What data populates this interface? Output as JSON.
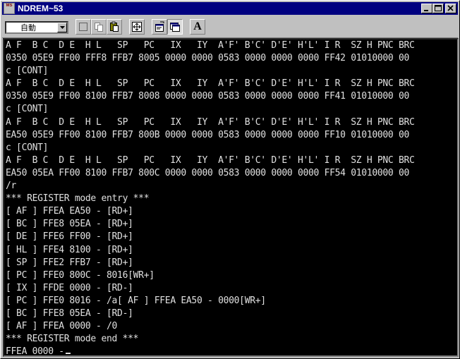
{
  "window": {
    "title": "NDREM~53",
    "icon_text": "MS"
  },
  "titlebar_buttons": {
    "minimize": "minimize-icon",
    "maximize": "maximize-icon",
    "close": "close-icon"
  },
  "toolbar": {
    "font_select_value": "自動",
    "tools": [
      "mark-icon",
      "copy-icon",
      "paste-icon",
      "fullscreen-icon",
      "properties-icon",
      "background-icon",
      "font-icon"
    ],
    "font_button_label": "A"
  },
  "console": {
    "lines": [
      "A F  B C  D E  H L   SP   PC   IX   IY  A'F' B'C' D'E' H'L' I R  SZ H PNC BRC",
      "0350 05E9 FF00 FFF8 FFB7 8005 0000 0000 0583 0000 0000 0000 FF42 01010000 00",
      "c [CONT]",
      "A F  B C  D E  H L   SP   PC   IX   IY  A'F' B'C' D'E' H'L' I R  SZ H PNC BRC",
      "0350 05E9 FF00 8100 FFB7 8008 0000 0000 0583 0000 0000 0000 FF41 01010000 00",
      "c [CONT]",
      "A F  B C  D E  H L   SP   PC   IX   IY  A'F' B'C' D'E' H'L' I R  SZ H PNC BRC",
      "EA50 05E9 FF00 8100 FFB7 800B 0000 0000 0583 0000 0000 0000 FF10 01010000 00",
      "c [CONT]",
      "A F  B C  D E  H L   SP   PC   IX   IY  A'F' B'C' D'E' H'L' I R  SZ H PNC BRC",
      "EA50 05EA FF00 8100 FFB7 800C 0000 0000 0583 0000 0000 0000 FF54 01010000 00",
      "/r",
      "*** REGISTER mode entry ***",
      "[ AF ] FFEA EA50 - [RD+]",
      "[ BC ] FFE8 05EA - [RD+]",
      "[ DE ] FFE6 FF00 - [RD+]",
      "[ HL ] FFE4 8100 - [RD+]",
      "[ SP ] FFE2 FFB7 - [RD+]",
      "[ PC ] FFE0 800C - 8016[WR+]",
      "[ IX ] FFDE 0000 - [RD-]",
      "[ PC ] FFE0 8016 - /a[ AF ] FFEA EA50 - 0000[WR+]",
      "[ BC ] FFE8 05EA - [RD-]",
      "[ AF ] FFEA 0000 - /0",
      "*** REGISTER mode end ***",
      "FFEA 0000 -"
    ]
  },
  "colors": {
    "titlebar": "#000080",
    "console_bg": "#000000",
    "console_fg": "#e0e0e0",
    "chrome": "#c0c0c0"
  }
}
